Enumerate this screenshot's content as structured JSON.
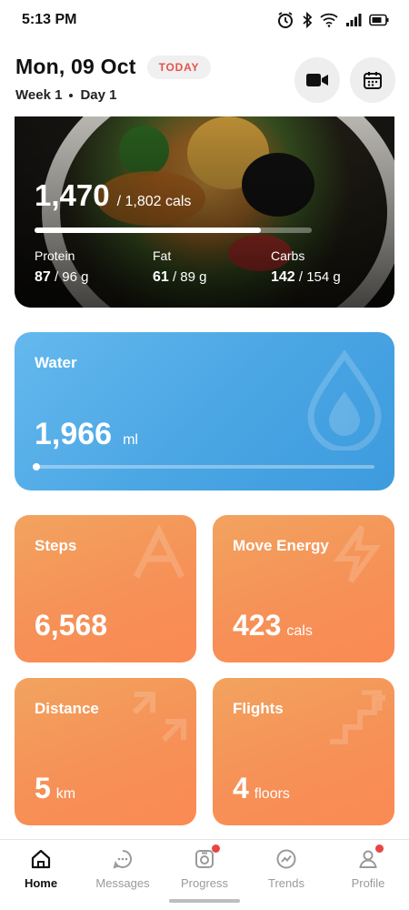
{
  "status_bar": {
    "time": "5:13 PM",
    "icons": [
      "alarm-icon",
      "bluetooth-icon",
      "wifi-icon",
      "signal-icon",
      "battery-icon"
    ]
  },
  "header": {
    "date": "Mon, 09 Oct",
    "today_label": "TODAY",
    "week_label": "Week 1",
    "day_label": "Day 1",
    "buttons": [
      "video-camera-icon",
      "calendar-icon"
    ]
  },
  "nutrition": {
    "calories_consumed": "1,470",
    "calories_target": "/ 1,802 cals",
    "calories_progress": 0.816,
    "macros": [
      {
        "label": "Protein",
        "value": "87",
        "target": "/ 96 g"
      },
      {
        "label": "Fat",
        "value": "61",
        "target": "/ 89 g"
      },
      {
        "label": "Carbs",
        "value": "142",
        "target": "/ 154 g"
      }
    ]
  },
  "water": {
    "title": "Water",
    "value": "1,966",
    "unit": "ml",
    "progress": 0.0
  },
  "tiles": {
    "steps": {
      "title": "Steps",
      "value": "6,568",
      "unit": ""
    },
    "move": {
      "title": "Move Energy",
      "value": "423",
      "unit": "cals"
    },
    "distance": {
      "title": "Distance",
      "value": "5",
      "unit": "km"
    },
    "flights": {
      "title": "Flights",
      "value": "4",
      "unit": "floors"
    }
  },
  "nav": {
    "items": [
      {
        "label": "Home",
        "icon": "home-icon",
        "active": true,
        "badge": false
      },
      {
        "label": "Messages",
        "icon": "messages-icon",
        "active": false,
        "badge": false
      },
      {
        "label": "Progress",
        "icon": "progress-camera-icon",
        "active": false,
        "badge": true
      },
      {
        "label": "Trends",
        "icon": "trends-icon",
        "active": false,
        "badge": false
      },
      {
        "label": "Profile",
        "icon": "profile-icon",
        "active": false,
        "badge": true
      }
    ]
  },
  "colors": {
    "today_red": "#e5534b",
    "water_blue": "#4aa5e3",
    "tile_orange": "#f69157",
    "badge_red": "#e94545"
  }
}
